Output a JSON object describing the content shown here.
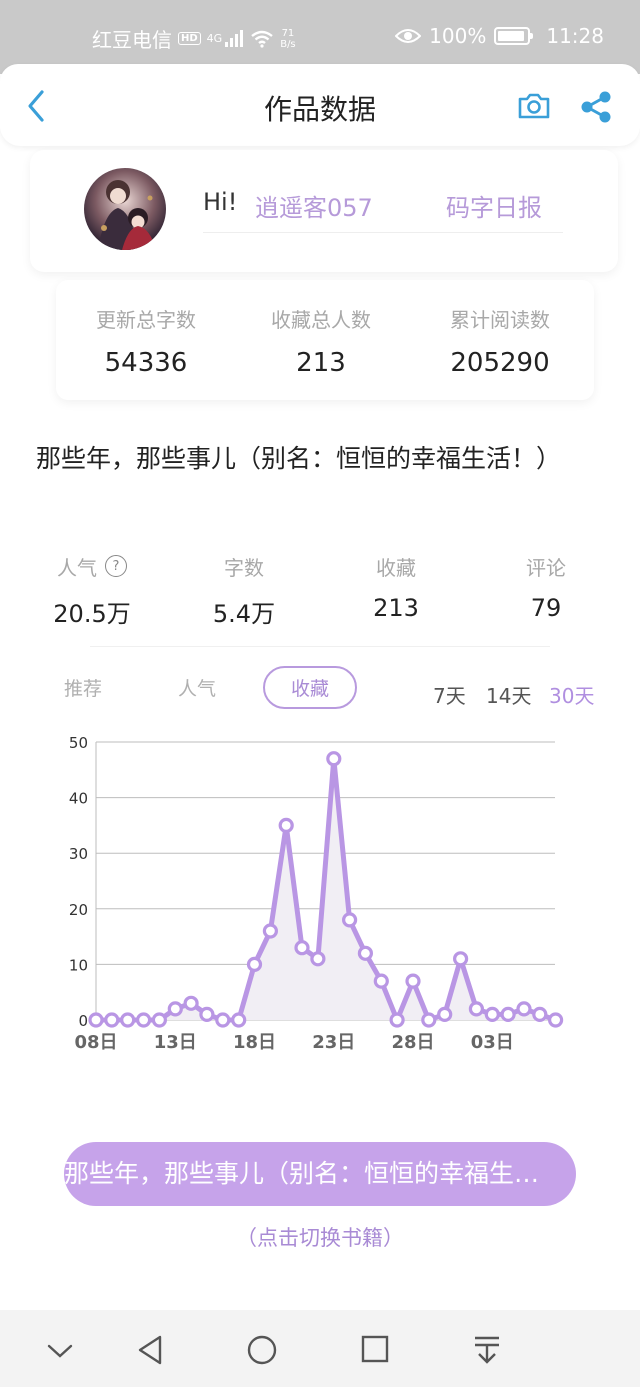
{
  "status_bar": {
    "carrier": "红豆电信",
    "hd_badge": "HD",
    "network": "4G",
    "speed_value": "71",
    "speed_unit": "B/s",
    "battery": "100%",
    "time": "11:28"
  },
  "nav": {
    "title": "作品数据",
    "back_icon": "chevron-left-icon",
    "camera_icon": "camera-icon",
    "share_icon": "share-icon",
    "accent_color": "#3a9fd8"
  },
  "user": {
    "greeting": "Hi!",
    "username": "逍遥客057",
    "daily_report": "码字日报"
  },
  "totals": [
    {
      "label": "更新总字数",
      "value": "54336"
    },
    {
      "label": "收藏总人数",
      "value": "213"
    },
    {
      "label": "累计阅读数",
      "value": "205290"
    }
  ],
  "book": {
    "title": "那些年，那些事儿（别名：恒恒的幸福生活！）"
  },
  "metrics": [
    {
      "label": "人气",
      "value": "20.5万"
    },
    {
      "label": "字数",
      "value": "5.4万"
    },
    {
      "label": "收藏",
      "value": "213"
    },
    {
      "label": "评论",
      "value": "79"
    }
  ],
  "chart_tabs": {
    "tabs": [
      "推荐",
      "人气",
      "收藏"
    ],
    "selected": "收藏",
    "ranges": [
      "7天",
      "14天",
      "30天"
    ],
    "selected_range": "30天"
  },
  "chart_data": {
    "type": "area",
    "title": "",
    "xlabel": "",
    "ylabel": "",
    "ylim": [
      0,
      50
    ],
    "yticks": [
      0,
      10,
      20,
      30,
      40,
      50
    ],
    "x_tick_labels": [
      "08日",
      "13日",
      "18日",
      "23日",
      "28日",
      "03日"
    ],
    "x": [
      "08日",
      "09日",
      "10日",
      "11日",
      "12日",
      "13日",
      "14日",
      "15日",
      "16日",
      "17日",
      "18日",
      "19日",
      "20日",
      "21日",
      "22日",
      "23日",
      "24日",
      "25日",
      "26日",
      "27日",
      "28日",
      "29日",
      "30日",
      "31日",
      "01日",
      "02日",
      "03日",
      "04日",
      "05日",
      "06日",
      "07日"
    ],
    "values": [
      0,
      0,
      0,
      0,
      0,
      2,
      3,
      1,
      0,
      0,
      10,
      16,
      35,
      13,
      11,
      47,
      18,
      12,
      7,
      0,
      7,
      0,
      1,
      11,
      2,
      1,
      1,
      2,
      1,
      0
    ],
    "grid": true,
    "line_color": "#b996e4",
    "fill_color": "#f1eef4"
  },
  "footer": {
    "switch_button": "那些年，那些事儿（别名：恒恒的幸福生活！）",
    "switch_hint": "（点击切换书籍）"
  }
}
